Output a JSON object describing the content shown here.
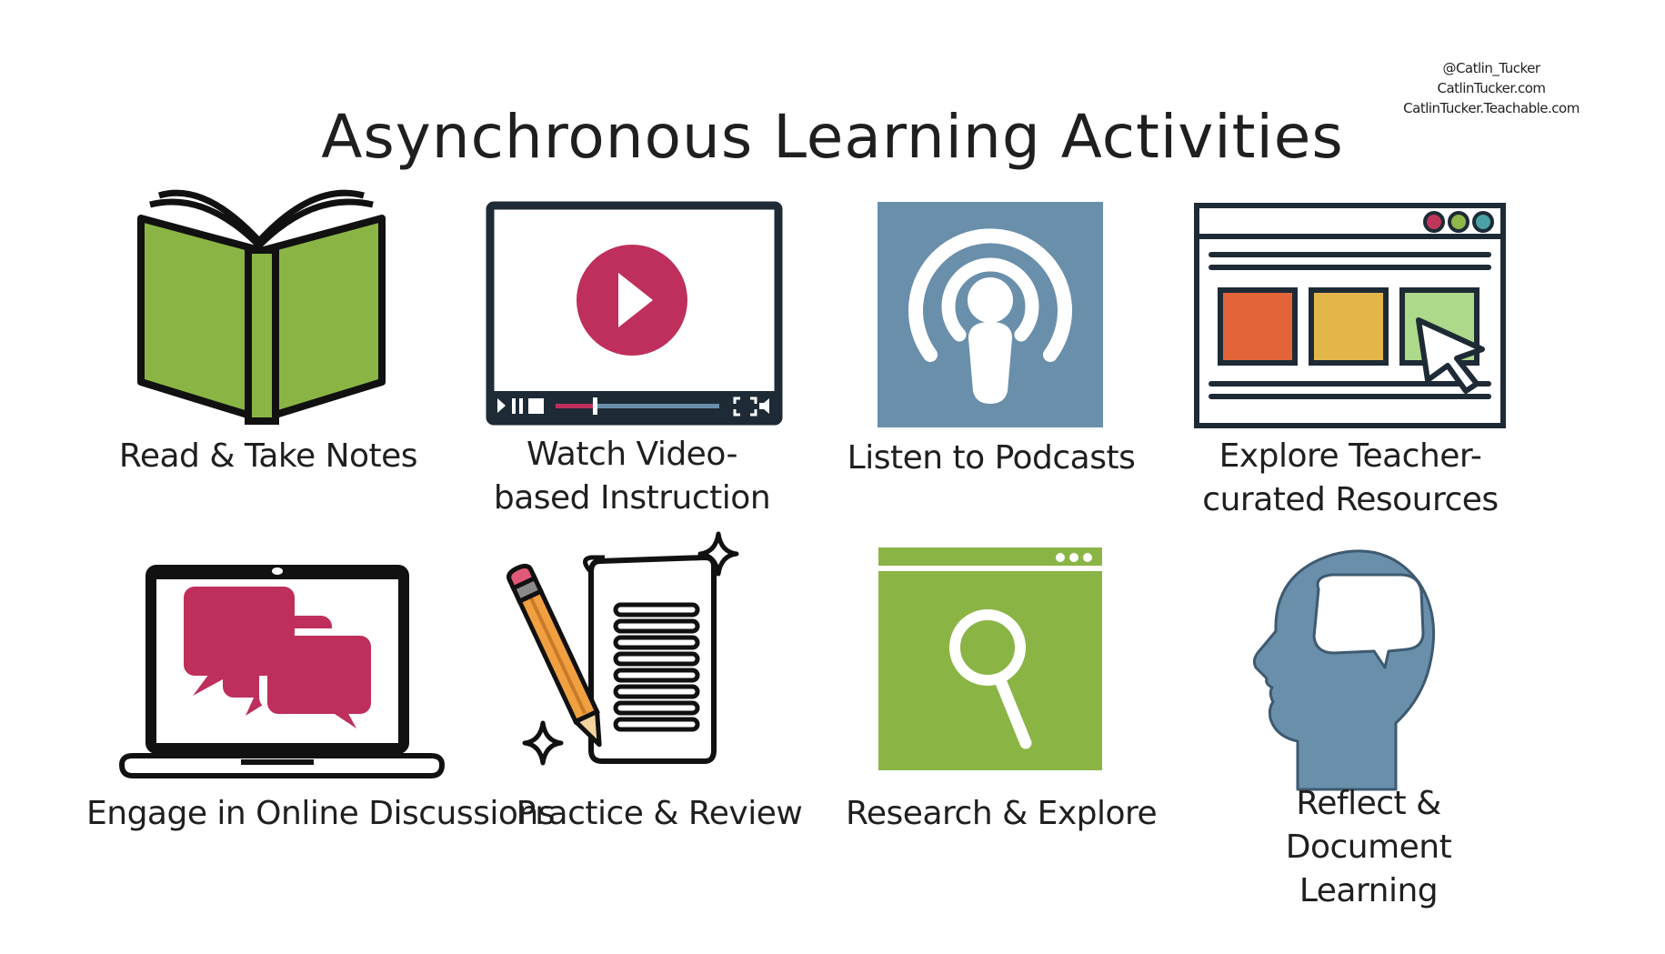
{
  "credits": [
    "@Catlin_Tucker",
    "CatlinTucker.com",
    "CatlinTucker.Teachable.com"
  ],
  "title": "Asynchronous Learning Activities",
  "activities": [
    {
      "label": "Read & Take Notes",
      "icon": "open-book-icon"
    },
    {
      "label": "Watch Video-based Instruction",
      "icon": "video-player-icon"
    },
    {
      "label": "Listen to Podcasts",
      "icon": "podcast-icon"
    },
    {
      "label": "Explore Teacher-curated Resources",
      "icon": "browser-window-icon"
    },
    {
      "label": "Engage in Online Discussions",
      "icon": "laptop-chat-icon"
    },
    {
      "label": "Practice & Review",
      "icon": "pencil-paper-icon"
    },
    {
      "label": "Research & Explore",
      "icon": "magnifier-window-icon"
    },
    {
      "label": "Reflect & Document Learning",
      "icon": "head-thought-icon"
    }
  ],
  "colors": {
    "green": "#8ab545",
    "magenta": "#bf2f5c",
    "steel_blue": "#6a8fab",
    "dark_outline": "#1e2b36",
    "orange": "#e4643a",
    "gold": "#e3b64a",
    "light_green": "#acd98a"
  }
}
